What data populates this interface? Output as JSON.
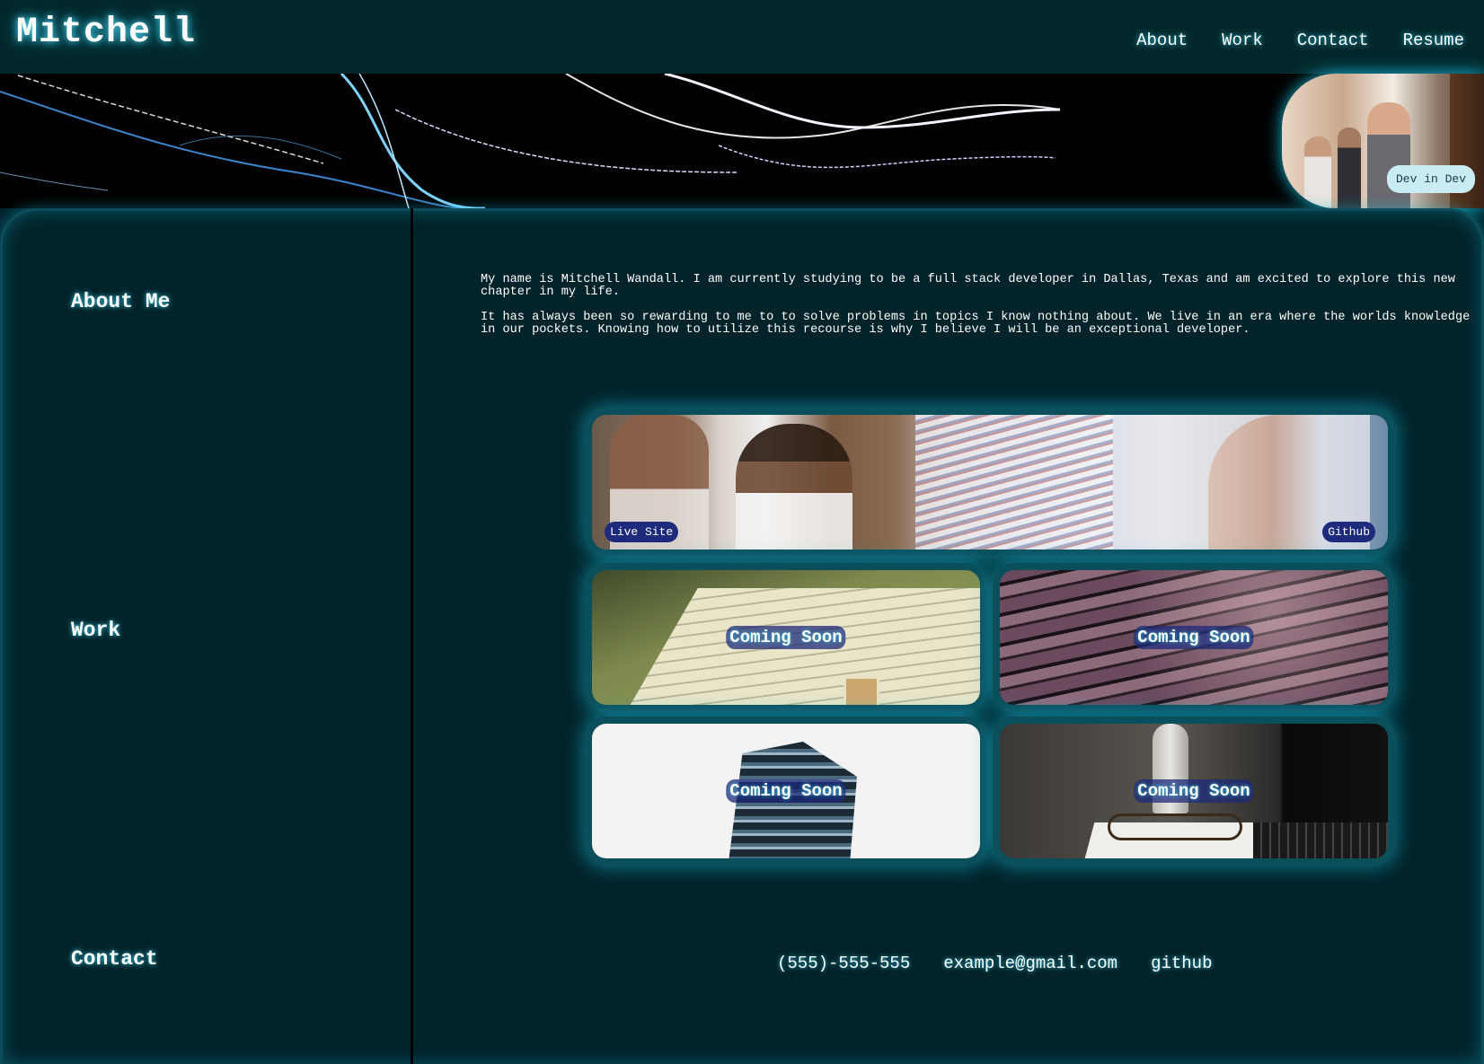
{
  "header": {
    "brand": "Mitchell",
    "nav": [
      "About",
      "Work",
      "Contact",
      "Resume"
    ]
  },
  "banner": {
    "badge": "Dev in Dev"
  },
  "sidebar": {
    "items": [
      "About Me",
      "Work",
      "Contact"
    ]
  },
  "about": {
    "paragraphs": [
      "My name is Mitchell Wandall. I am currently studying to be a full stack developer in Dallas, Texas and am excited to explore this new chapter in my life.",
      "It has always been so rewarding to me to to solve problems in topics I know nothing about. We live in an era where the worlds knowledge in our pockets. Knowing how to utilize this recourse is why I believe I will be an exceptional developer."
    ]
  },
  "projects": {
    "featured": {
      "live_label": "Live Site",
      "github_label": "Github"
    },
    "coming_soon_label": "Coming Soon"
  },
  "footer": {
    "phone": "(555)-555-555",
    "email": "example@gmail.com",
    "github": "github"
  },
  "colors": {
    "background": "#02232a",
    "header": "#03282c",
    "glow": "#17b8d6",
    "pill": "#1e2a7c"
  }
}
